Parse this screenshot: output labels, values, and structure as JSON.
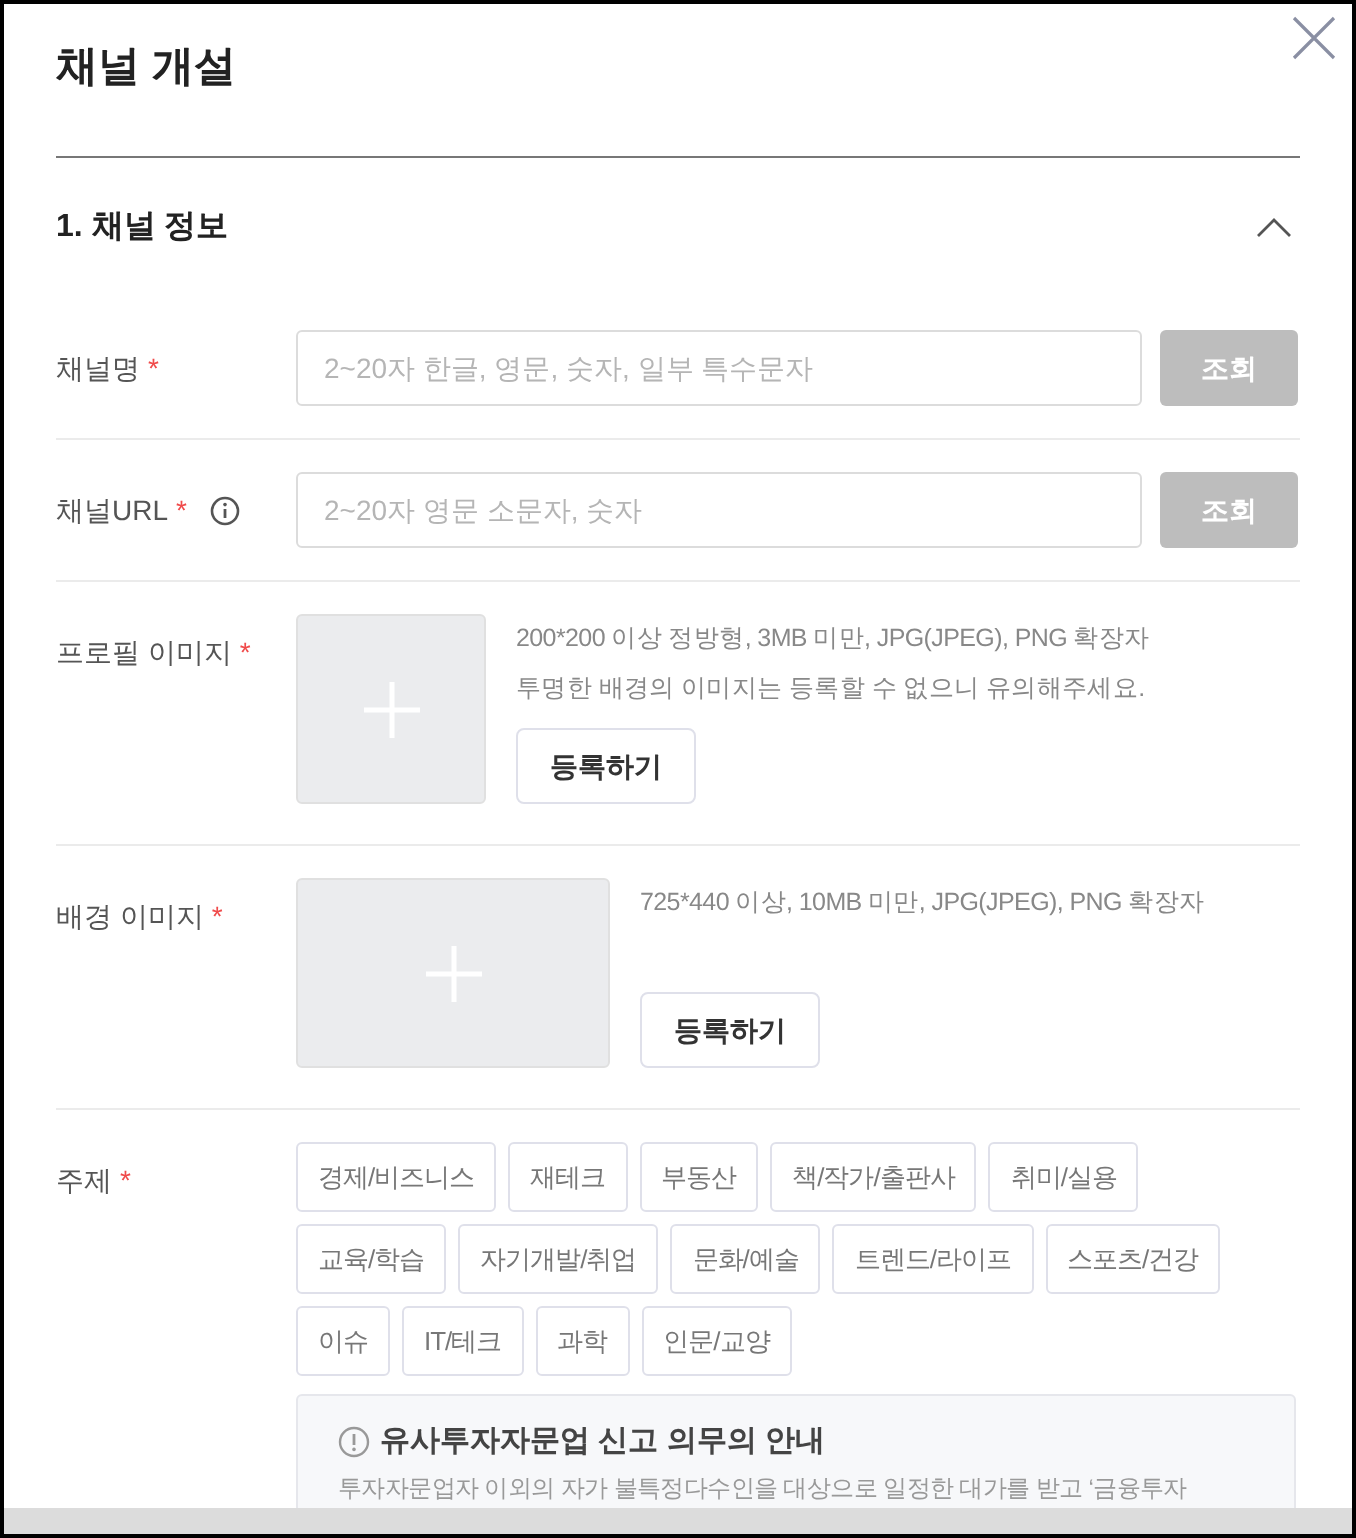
{
  "dialog": {
    "title": "채널 개설"
  },
  "section": {
    "title": "1. 채널 정보",
    "expanded": true
  },
  "fields": [
    {
      "kind": "text",
      "label": "채널명",
      "required": "*",
      "placeholder": "2~20자 한글, 영문, 숫자, 일부 특수문자",
      "button": "조회",
      "button_disabled": true
    },
    {
      "kind": "text",
      "label": "채널URL",
      "required": "*",
      "info": true,
      "placeholder": "2~20자 영문 소문자, 숫자",
      "button": "조회",
      "button_disabled": true
    },
    {
      "kind": "square_image",
      "label": "프로필 이미지",
      "required": "*",
      "hints": [
        "200*200 이상 정방형, 3MB 미만, JPG(JPEG), PNG 확장자",
        "투명한 배경의 이미지는 등록할 수 없으니 유의해주세요."
      ],
      "button": "등록하기"
    },
    {
      "kind": "wide_image",
      "label": "배경 이미지",
      "required": "*",
      "hints": [
        "725*440 이상, 10MB 미만, JPG(JPEG), PNG 확장자"
      ],
      "button": "등록하기"
    },
    {
      "kind": "tags",
      "label": "주제",
      "required": "*",
      "tags": [
        {
          "label": "경제/비즈니스",
          "selected": false
        },
        {
          "label": "재테크",
          "selected": false
        },
        {
          "label": "부동산",
          "selected": false
        },
        {
          "label": "책/작가/출판사",
          "selected": false
        },
        {
          "label": "취미/실용",
          "selected": false
        },
        {
          "label": "교육/학습",
          "selected": false
        },
        {
          "label": "자기개발/취업",
          "selected": false
        },
        {
          "label": "문화/예술",
          "selected": false
        },
        {
          "label": "트렌드/라이프",
          "selected": false
        },
        {
          "label": "스포츠/건강",
          "selected": false
        },
        {
          "label": "이슈",
          "selected": false
        },
        {
          "label": "IT/테크",
          "selected": false
        },
        {
          "label": "과학",
          "selected": false
        },
        {
          "label": "인문/교양",
          "selected": false
        }
      ],
      "notice": {
        "title": "유사투자자문업 신고 의무의 안내",
        "body": "투자자문업자 이외의 자가 불특정다수인을 대상으로 일정한 대가를 받고 ‘금융투자"
      }
    }
  ]
}
